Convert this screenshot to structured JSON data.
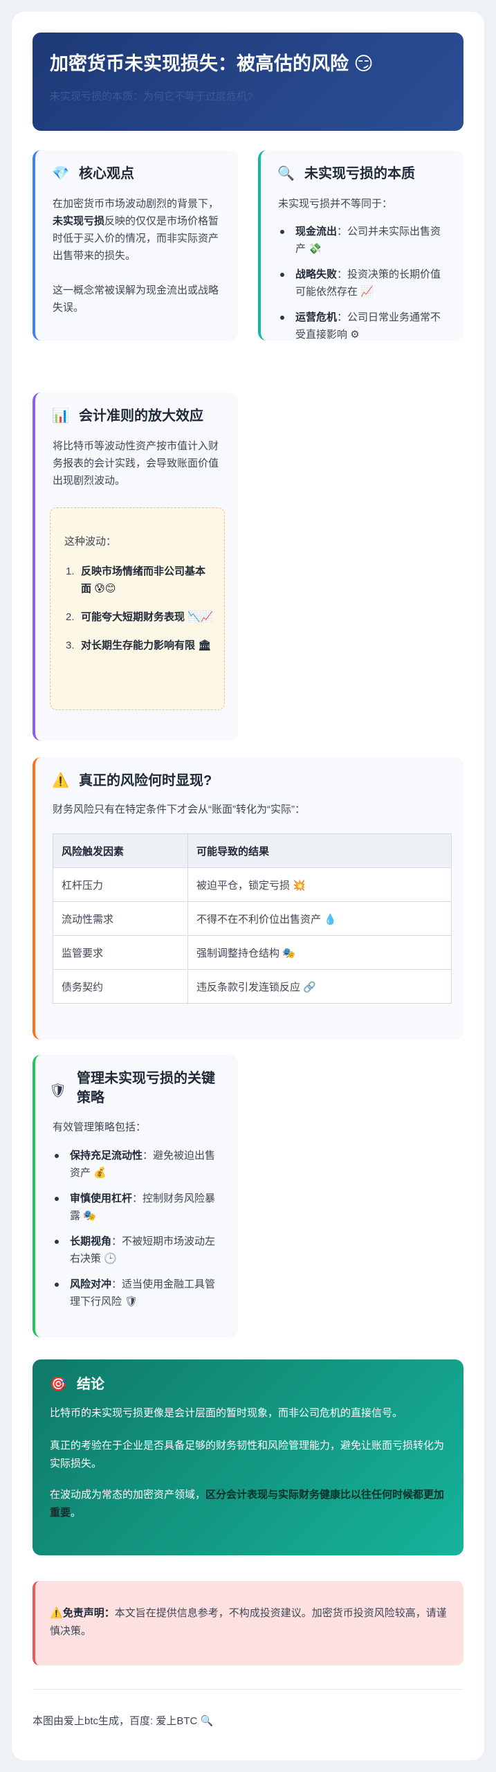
{
  "hero": {
    "title": "加密货币未实现损失：被高估的风险",
    "title_icon": "😏",
    "subtitle": "未实现亏损的本质：为何它不等于过度危机?"
  },
  "core": {
    "icon": "💎",
    "title": "核心观点",
    "p1_a": "在加密货币市场波动剧烈的背景下，",
    "p1_b": "未实现亏损",
    "p1_c": "反映的仅仅是市场价格暂时低于买入价的情况，而非实际资产出售带来的损失。",
    "p2": "这一概念常被误解为现金流出或战略失误。"
  },
  "nature": {
    "icon": "🔍",
    "title": "未实现亏损的本质",
    "intro": "未实现亏损并不等同于：",
    "items": [
      {
        "term": "现金流出",
        "desc": "：公司并未实际出售资产",
        "icon": "💸"
      },
      {
        "term": "战略失败",
        "desc": "：投资决策的长期价值可能依然存在",
        "icon": "📈"
      },
      {
        "term": "运营危机",
        "desc": "：公司日常业务通常不受直接影响",
        "icon": "⚙"
      }
    ]
  },
  "accounting": {
    "icon": "📊",
    "title": "会计准则的放大效应",
    "p": "将比特币等波动性资产按市值计入财务报表的会计实践，会导致账面价值出现剧烈波动。",
    "box_intro": "这种波动：",
    "items": [
      {
        "num": "1.",
        "text": "反映市场情绪而非公司基本面",
        "icon": "😰😊"
      },
      {
        "num": "2.",
        "text": "可能夸大短期财务表现",
        "icon": "📉📈"
      },
      {
        "num": "3.",
        "text": "对长期生存能力影响有限",
        "icon": "🏛"
      }
    ]
  },
  "risk": {
    "icon": "⚠️",
    "title": "真正的风险何时显现?",
    "intro": "财务风险只有在特定条件下才会从“账面”转化为“实际”：",
    "columns": [
      "风险触发因素",
      "可能导致的结果"
    ],
    "rows": [
      [
        "杠杆压力",
        "被迫平仓，锁定亏损",
        "💥"
      ],
      [
        "流动性需求",
        "不得不在不利价位出售资产",
        "💧"
      ],
      [
        "监管要求",
        "强制调整持仓结构",
        "🎭"
      ],
      [
        "债务契约",
        "违反条款引发连锁反应",
        "🔗"
      ]
    ]
  },
  "manage": {
    "icon": "🛡",
    "title_1": "管理未实现亏损的关键",
    "title_2": "策略",
    "intro": "有效管理策略包括：",
    "items": [
      {
        "term": "保持充足流动性",
        "desc": "：避免被迫出售资产",
        "icon": "💰"
      },
      {
        "term": "审慎使用杠杆",
        "desc": "：控制财务风险暴露",
        "icon": "🎭"
      },
      {
        "term": "长期视角",
        "desc": "：不被短期市场波动左右决策",
        "icon": "🕒"
      },
      {
        "term": "风险对冲",
        "desc": "：适当使用金融工具管理下行风险",
        "icon": "🛡"
      }
    ]
  },
  "conclusion": {
    "icon": "🎯",
    "title": "结论",
    "p1": "比特币的未实现亏损更像是会计层面的暂时现象，而非公司危机的直接信号。",
    "p2": "真正的考验在于企业是否具备足够的财务韧性和风险管理能力，避免让账面亏损转化为实际损失。",
    "p3_a": "在波动成为常态的加密资产领域，",
    "p3_b": "区分会计表现与实际财务健康比以往任何时候都更加重要",
    "p3_c": "。"
  },
  "disclaimer": {
    "icon": "⚠️",
    "label": "免责声明：",
    "text": "本文旨在提供信息参考，不构成投资建议。加密货币投资风险较高，请谨慎决策。"
  },
  "footer": {
    "text": "本图由爱上btc生成，百度: 爱上BTC",
    "icon": "🔍"
  },
  "colors": {
    "hero": "#1e3a78",
    "accent_blue": "#3b82f6",
    "accent_teal": "#14b8a6",
    "accent_purple": "#8b5cf6",
    "accent_orange": "#f97316",
    "accent_green": "#22c55e",
    "conclusion": "#0f8a74",
    "disclaimer_bg": "#fde1e1",
    "disclaimer_border": "#e35d5d"
  }
}
